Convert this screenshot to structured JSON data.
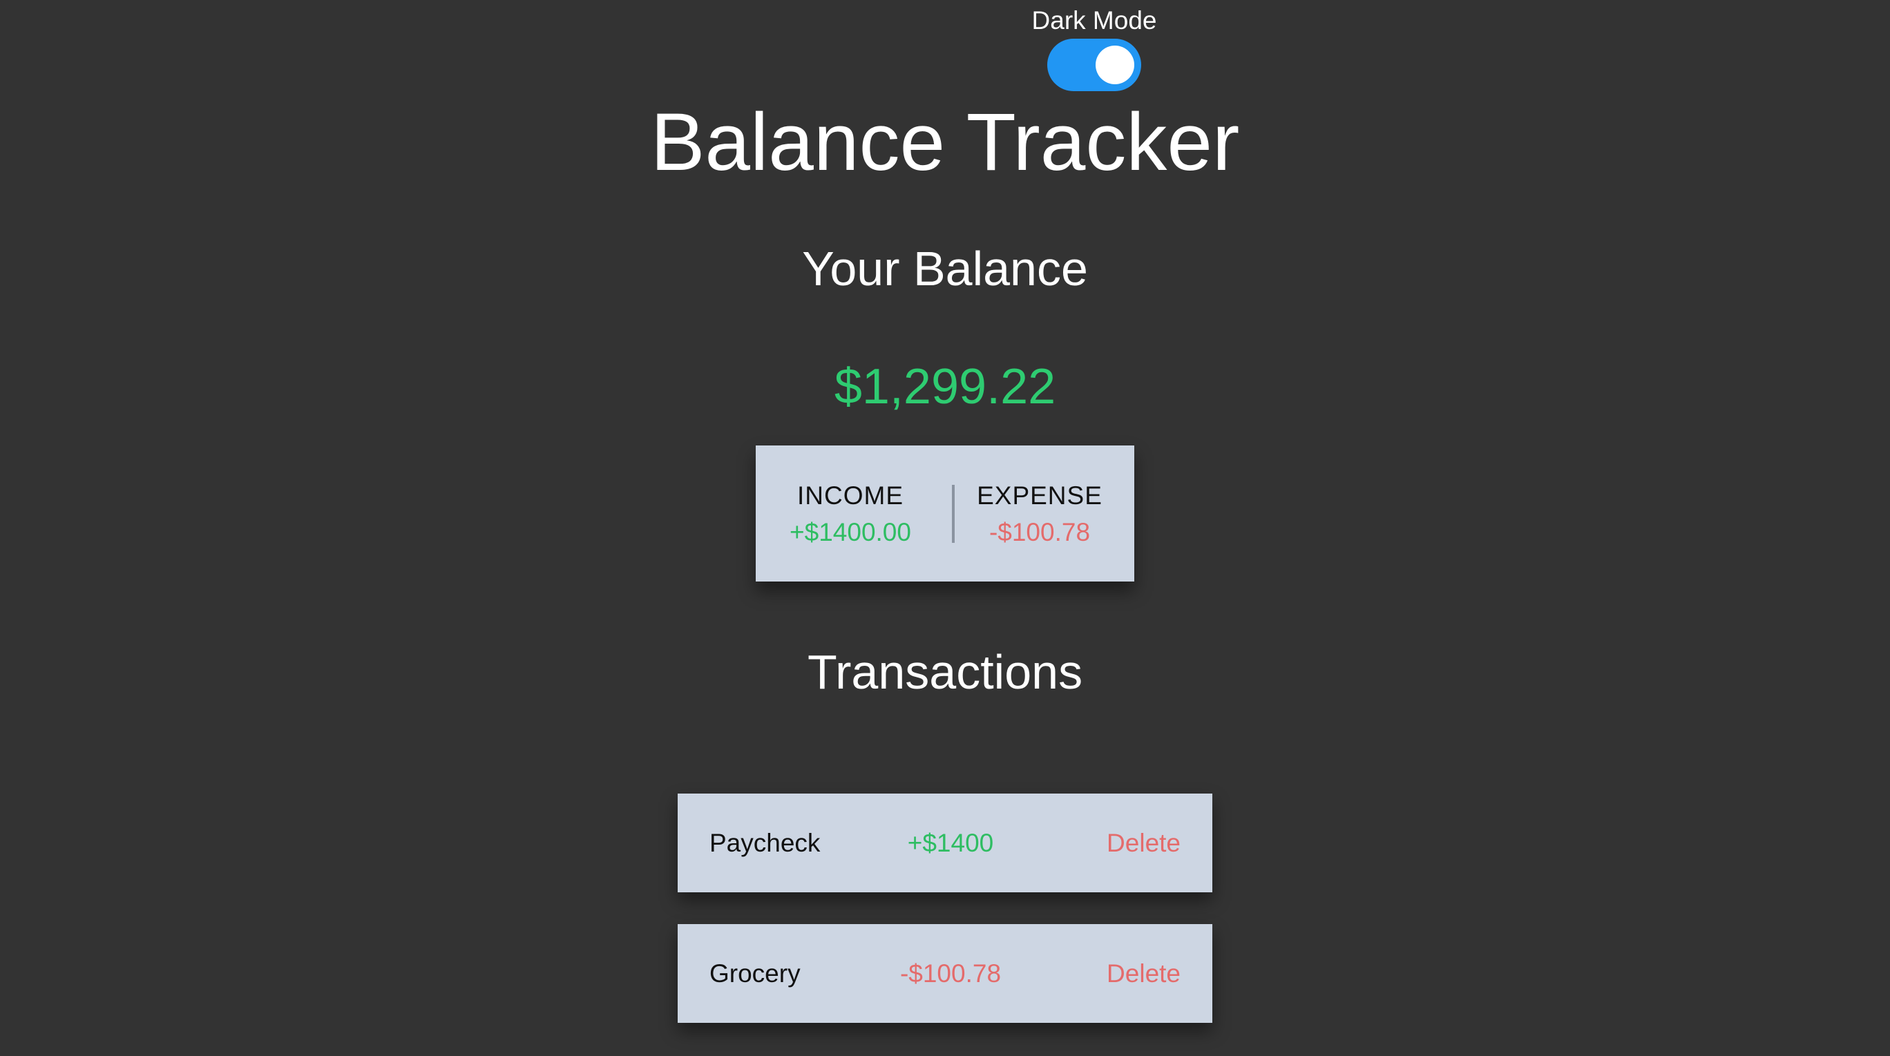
{
  "toggle": {
    "label": "Dark Mode",
    "state": "on",
    "color": "#2196f3"
  },
  "header": {
    "title": "Balance Tracker"
  },
  "balance": {
    "label": "Your Balance",
    "value": "$1,299.22",
    "color": "#2ecc71"
  },
  "summary": {
    "income_label": "INCOME",
    "income_value": "+$1400.00",
    "expense_label": "EXPENSE",
    "expense_value": "-$100.78"
  },
  "transactions": {
    "title": "Transactions",
    "items": [
      {
        "name": "Paycheck",
        "amount": "+$1400",
        "type": "income",
        "action": "Delete"
      },
      {
        "name": "Grocery",
        "amount": "-$100.78",
        "type": "expense",
        "action": "Delete"
      }
    ]
  },
  "colors": {
    "background": "#333333",
    "card": "#cdd6e3",
    "positive": "#2ebd62",
    "negative": "#e46b6b"
  }
}
